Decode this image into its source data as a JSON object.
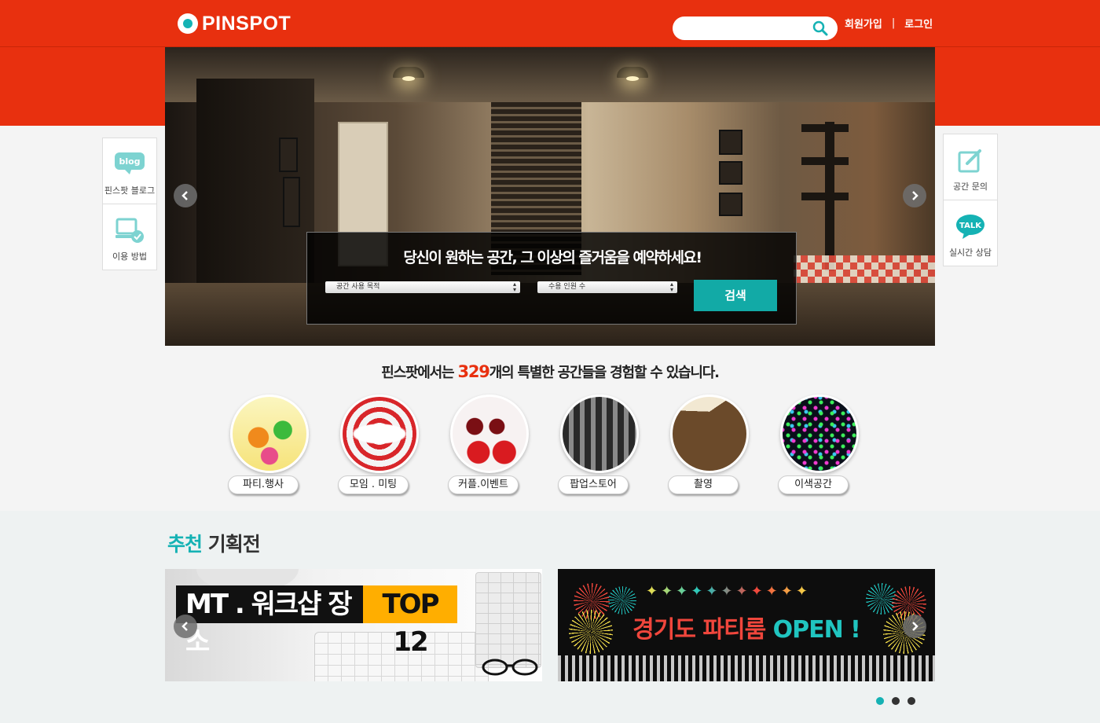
{
  "header": {
    "logo_text": "PINSPOT",
    "search_placeholder": "",
    "signup_label": "회원가입",
    "separator": "|",
    "login_label": "로그인"
  },
  "hero": {
    "title": "당신이 원하는 공간, 그 이상의 즐거움을 예약하세요!",
    "purpose_select": "공간 사용 목적",
    "capacity_select": "수용 인원 수",
    "search_button": "검색"
  },
  "side_left": [
    {
      "label": "핀스팟 블로그",
      "icon": "blog-icon",
      "icon_text": "blog"
    },
    {
      "label": "이용 방법",
      "icon": "monitor-check-icon"
    }
  ],
  "side_right": [
    {
      "label": "공간 문의",
      "icon": "edit-icon"
    },
    {
      "label": "실시간 상담",
      "icon": "talk-icon",
      "icon_text": "TALK"
    }
  ],
  "tagline": {
    "before": "핀스팟에서는 ",
    "count": "329",
    "after": "개의 특별한 공간들을 경험할 수 있습니다."
  },
  "categories": [
    {
      "label": "파티.행사"
    },
    {
      "label": "모임 . 미팅"
    },
    {
      "label": "커플.이벤트"
    },
    {
      "label": "팝업스토어"
    },
    {
      "label": "촬영"
    },
    {
      "label": "이색공간"
    }
  ],
  "recommend": {
    "title_accent": "추천",
    "title_rest": " 기획전",
    "banner1_black": "MT . 워크샵 장소",
    "banner1_yellow": "TOP 12",
    "banner2_red": "경기도 파티룸",
    "banner2_teal": "OPEN !",
    "banner2_sparkles": "✦✦✦✦✦✦✦✦✦✦✦"
  },
  "pagination": {
    "total": 3,
    "active": 0
  },
  "colors": {
    "brand_red": "#e8300f",
    "accent_teal": "#15b2b4",
    "search_button": "#12aaa6",
    "highlight_yellow": "#ffae00"
  }
}
